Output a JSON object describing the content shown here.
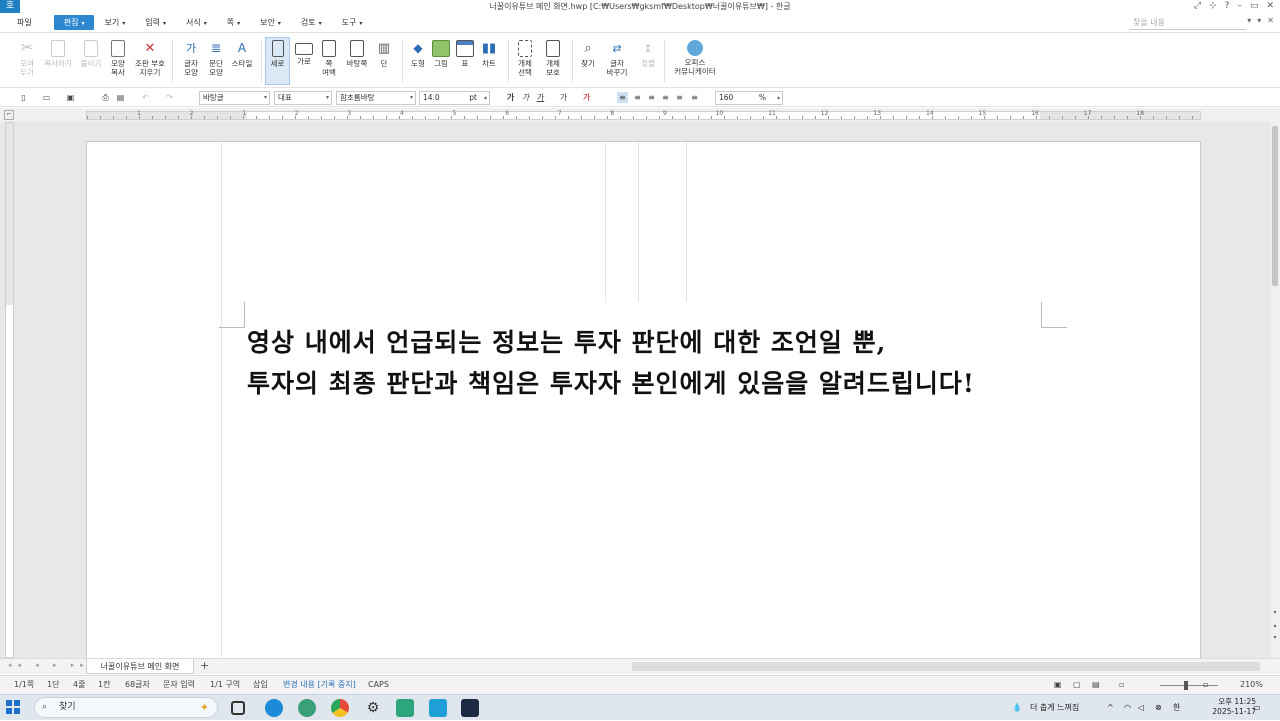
{
  "titlebar": {
    "logo": "호",
    "title": "너꿀이유튜브 메인 화면.hwp [C:₩Users₩gksmf₩Desktop₩너꿀이유튜브₩] - 한글",
    "controls": [
      "⤢",
      "⊹",
      "?",
      "–",
      "▭",
      "✕"
    ]
  },
  "menubar": {
    "items": [
      {
        "label": "파일"
      },
      {
        "label": "편집"
      },
      {
        "label": "보기"
      },
      {
        "label": "입력"
      },
      {
        "label": "서식"
      },
      {
        "label": "쪽"
      },
      {
        "label": "보안"
      },
      {
        "label": "검토"
      },
      {
        "label": "도구"
      }
    ],
    "search_placeholder": "찾을 내용",
    "right_controls": [
      "▾",
      "▾",
      "✕"
    ]
  },
  "ribbon": {
    "cut": "오려\n두기",
    "copy": "복사하기",
    "paste": "붙이기",
    "format_copy": "모양\n복사",
    "erase_marks": "조판 부호\n지우기",
    "char_shape": "글자\n모양",
    "para_shape": "문단\n모양",
    "style": "스타일",
    "portrait": "세로",
    "landscape": "가로",
    "margin": "쪽\n여백",
    "background": "바탕쪽",
    "columns": "단",
    "shape": "도형",
    "picture": "그림",
    "table": "표",
    "chart": "차트",
    "obj_select": "개체\n선택",
    "obj_protect": "개체\n보호",
    "find": "찾기",
    "replace": "글자\n바꾸기",
    "align": "정렬",
    "office": "오피스\n커뮤니케이터"
  },
  "format_toolbar": {
    "style_name": "바탕글",
    "lang": "대표",
    "font": "함초롬바탕",
    "size": "14.0",
    "size_unit": "pt",
    "zoom": "160",
    "zoom_unit": "%"
  },
  "ruler_numbers": [
    "1",
    "2",
    "1",
    "2",
    "3",
    "4",
    "5",
    "6",
    "7",
    "8",
    "9",
    "10",
    "11",
    "12",
    "13",
    "14",
    "15",
    "16",
    "17",
    "18"
  ],
  "document": {
    "line1": "영상 내에서 언급되는 정보는 투자 판단에 대한 조언일 뿐,",
    "line2": "투자의 최종 판단과 책임은 투자자 본인에게 있음을 알려드립니다!"
  },
  "tabs": {
    "nav": "◂◂ ◂ ▸ ▸▸",
    "active": "너꿀이유튜브 메인 화면",
    "add": "+"
  },
  "status": {
    "page": "1/1쪽",
    "section": "1단",
    "line": "4줄",
    "col": "1칸",
    "chars": "68글자",
    "mode": "문자 입력",
    "area": "1/1 구역",
    "insert": "삽입",
    "track": "변경 내용 [기록 중지]",
    "caps": "CAPS",
    "zoom": "210%"
  },
  "taskbar": {
    "search": "찾기",
    "tray_text": "더 춥게 느껴짐",
    "time": "오후 11:25",
    "date": "2025-11-17"
  },
  "colors": {
    "accent": "#2d88cf",
    "taskbar": "#dfe6ee"
  }
}
